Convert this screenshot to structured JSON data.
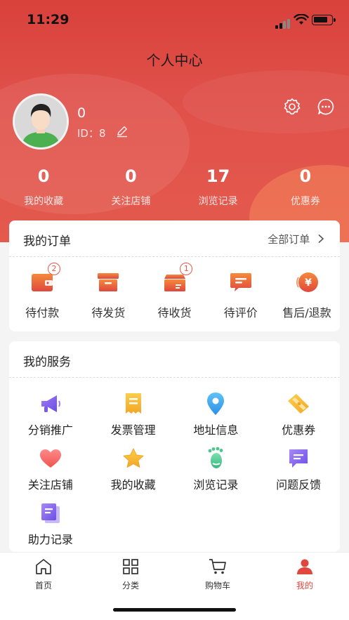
{
  "status": {
    "time": "11:29"
  },
  "header": {
    "title": "个人中心"
  },
  "profile": {
    "name": "0",
    "id_text": "ID：8"
  },
  "stats": [
    {
      "value": "0",
      "label": "我的收藏"
    },
    {
      "value": "0",
      "label": "关注店铺"
    },
    {
      "value": "17",
      "label": "浏览记录"
    },
    {
      "value": "0",
      "label": "优惠券"
    }
  ],
  "orders": {
    "title": "我的订单",
    "all_label": "全部订单",
    "items": [
      {
        "label": "待付款",
        "badge": "2",
        "icon": "wallet-icon"
      },
      {
        "label": "待发货",
        "badge": "",
        "icon": "box-icon"
      },
      {
        "label": "待收货",
        "badge": "1",
        "icon": "package-icon"
      },
      {
        "label": "待评价",
        "badge": "",
        "icon": "comment-icon"
      },
      {
        "label": "售后/退款",
        "badge": "",
        "icon": "refund-icon"
      }
    ]
  },
  "services": {
    "title": "我的服务",
    "items": [
      {
        "label": "分销推广",
        "icon": "megaphone-icon"
      },
      {
        "label": "发票管理",
        "icon": "invoice-icon"
      },
      {
        "label": "地址信息",
        "icon": "location-pin-icon"
      },
      {
        "label": "优惠券",
        "icon": "coupon-icon"
      },
      {
        "label": "关注店铺",
        "icon": "heart-icon"
      },
      {
        "label": "我的收藏",
        "icon": "star-icon"
      },
      {
        "label": "浏览记录",
        "icon": "footprint-icon"
      },
      {
        "label": "问题反馈",
        "icon": "feedback-icon"
      },
      {
        "label": "助力记录",
        "icon": "document-icon"
      }
    ]
  },
  "tabbar": [
    {
      "label": "首页",
      "icon": "home-icon"
    },
    {
      "label": "分类",
      "icon": "grid-icon"
    },
    {
      "label": "购物车",
      "icon": "cart-icon"
    },
    {
      "label": "我的",
      "icon": "user-icon"
    }
  ],
  "colors": {
    "accent": "#e0473d",
    "hero": "#d9413b"
  }
}
